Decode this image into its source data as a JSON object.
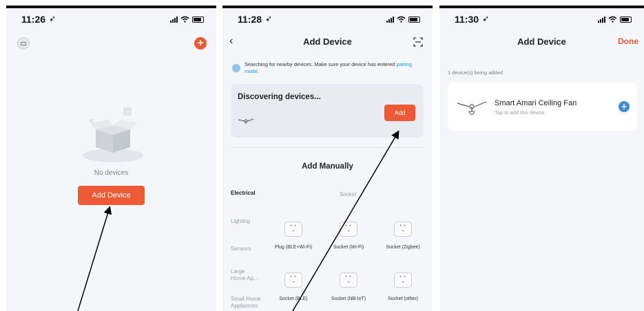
{
  "screens": [
    {
      "time": "11:26",
      "empty_text": "No devices",
      "add_button": "Add Device",
      "colors": {
        "accent": "#ee5a36"
      }
    },
    {
      "time": "11:28",
      "title": "Add Device",
      "search_notice": "Searching for nearby devices. Make sure your device has entered ",
      "pairing_link": "pairing mode.",
      "discover_label": "Discovering devices...",
      "add_label": "Add",
      "manual_title": "Add Manually",
      "category_header": "Electrical",
      "subheader": "Socket",
      "categories": [
        "Lighting",
        "Sensors",
        "Large Home Ap...",
        "Small Home Appliances"
      ],
      "devices_row1": [
        "Plug (BLE+Wi-Fi)",
        "Socket (Wi-Fi)",
        "Socket (Zigbee)"
      ],
      "devices_row2": [
        "Socket (BLE)",
        "Socket (NB-IoT)",
        "Socket (other)"
      ]
    },
    {
      "time": "11:30",
      "title": "Add Device",
      "done_label": "Done",
      "count_text": "1 device(s) being added",
      "device_name": "Smart Amari Ceiling Fan",
      "device_sub": "Tap to add this device"
    }
  ]
}
